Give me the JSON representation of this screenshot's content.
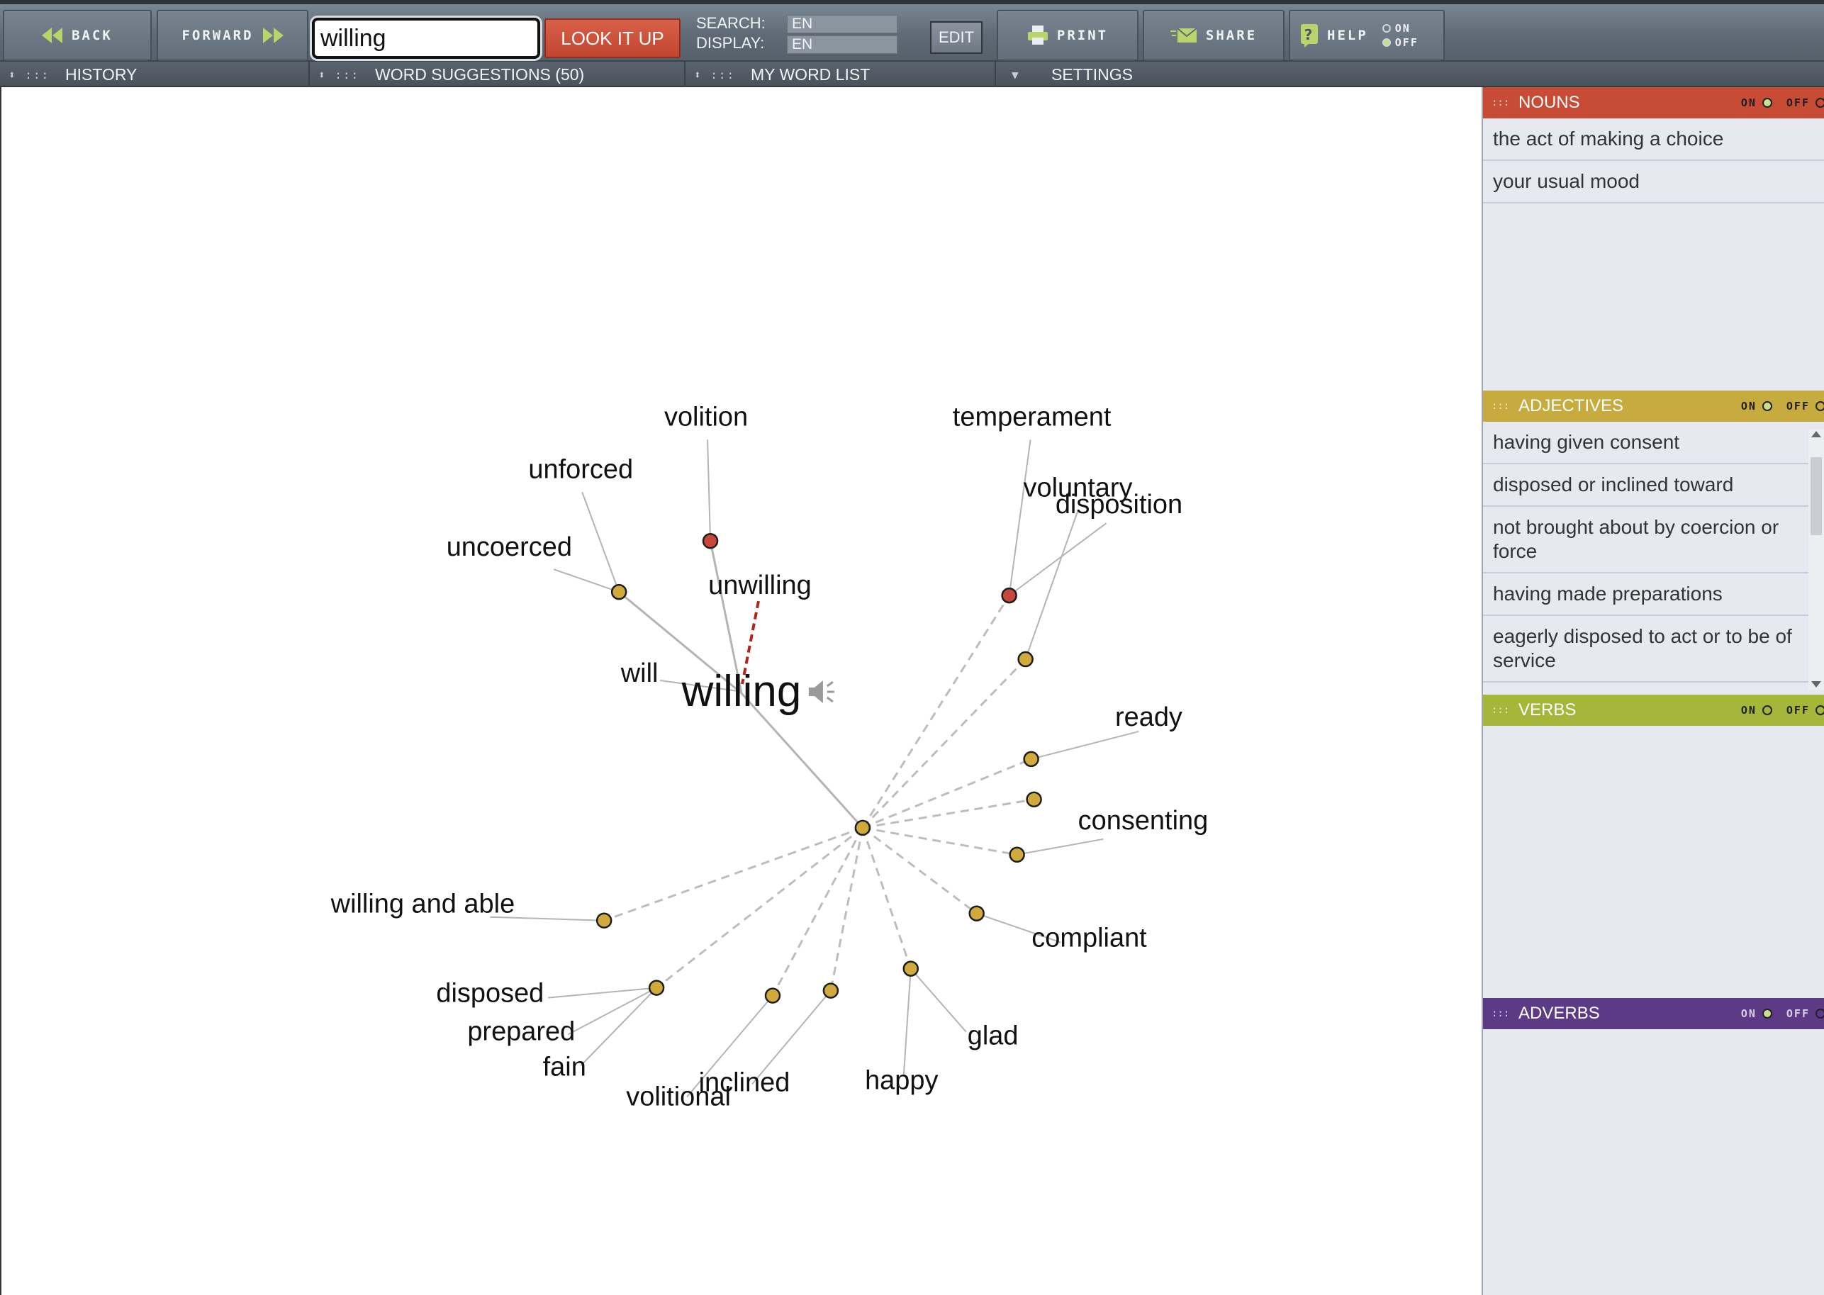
{
  "toolbar": {
    "back_label": "BACK",
    "forward_label": "FORWARD",
    "search_value": "willing",
    "lookup_label": "LOOK IT UP",
    "search_lang_label": "SEARCH:",
    "search_lang_value": "EN",
    "display_lang_label": "DISPLAY:",
    "display_lang_value": "EN",
    "edit_label": "EDIT",
    "print_label": "PRINT",
    "share_label": "SHARE",
    "help_label": "HELP",
    "help_on": "ON",
    "help_off": "OFF"
  },
  "sections": {
    "history": "HISTORY",
    "suggestions": "WORD SUGGESTIONS (50)",
    "mylist": "MY WORD LIST",
    "settings": "SETTINGS"
  },
  "graph": {
    "center": "willing",
    "words": [
      "volition",
      "temperament",
      "unforced",
      "voluntary",
      "disposition",
      "uncoerced",
      "unwilling",
      "will",
      "ready",
      "consenting",
      "willing and able",
      "compliant",
      "disposed",
      "glad",
      "prepared",
      "happy",
      "fain",
      "inclined",
      "volitional"
    ],
    "colors": {
      "noun_node": "#c8473a",
      "adj_node": "#d0aa3c",
      "antonym_line": "#b0261c"
    }
  },
  "definitions": {
    "nouns": {
      "title": "NOUNS",
      "on": "ON",
      "off": "OFF",
      "items": [
        "the act of making a choice",
        "your usual mood"
      ]
    },
    "adjectives": {
      "title": "ADJECTIVES",
      "on": "ON",
      "off": "OFF",
      "items": [
        "having given consent",
        "disposed or inclined toward",
        "not brought about by coercion or force",
        "having made preparations",
        "eagerly disposed to act or to be of service"
      ]
    },
    "verbs": {
      "title": "VERBS",
      "on": "ON",
      "off": "OFF",
      "items": []
    },
    "adverbs": {
      "title": "ADVERBS",
      "on": "ON",
      "off": "OFF",
      "items": []
    }
  },
  "icons": {
    "back": "double-left-arrow-icon",
    "forward": "double-right-arrow-icon",
    "print": "printer-icon",
    "share": "envelope-icon",
    "help": "question-icon",
    "speaker": "speaker-icon"
  }
}
